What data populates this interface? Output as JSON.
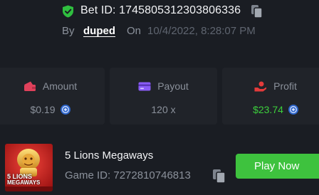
{
  "header": {
    "bet_id_label": "Bet ID:",
    "bet_id": "1745805312303806336",
    "by_label": "By",
    "username": "duped",
    "on_label": "On",
    "date": "10/4/2022, 8:28:07 PM"
  },
  "stats": {
    "amount": {
      "label": "Amount",
      "value": "$0.19",
      "icon": "wallet-icon",
      "currency_icon": "currency-coin-icon"
    },
    "payout": {
      "label": "Payout",
      "value": "120 x",
      "icon": "card-icon"
    },
    "profit": {
      "label": "Profit",
      "value": "$23.74",
      "icon": "hand-coin-icon",
      "currency_icon": "currency-coin-icon"
    }
  },
  "game": {
    "title": "5 Lions Megaways",
    "id_label": "Game ID:",
    "id": "7272810746813",
    "thumb_text_1": "5 LIONS",
    "thumb_text_2": "MEGAWAYS",
    "play_label": "Play Now"
  },
  "colors": {
    "background": "#1a1d23",
    "card": "#202329",
    "accent_green": "#3ec23e",
    "profit_green": "#3ccf3c",
    "amount_icon": "#e0415b",
    "payout_icon": "#8a5cf6",
    "profit_icon": "#e33b3b"
  }
}
